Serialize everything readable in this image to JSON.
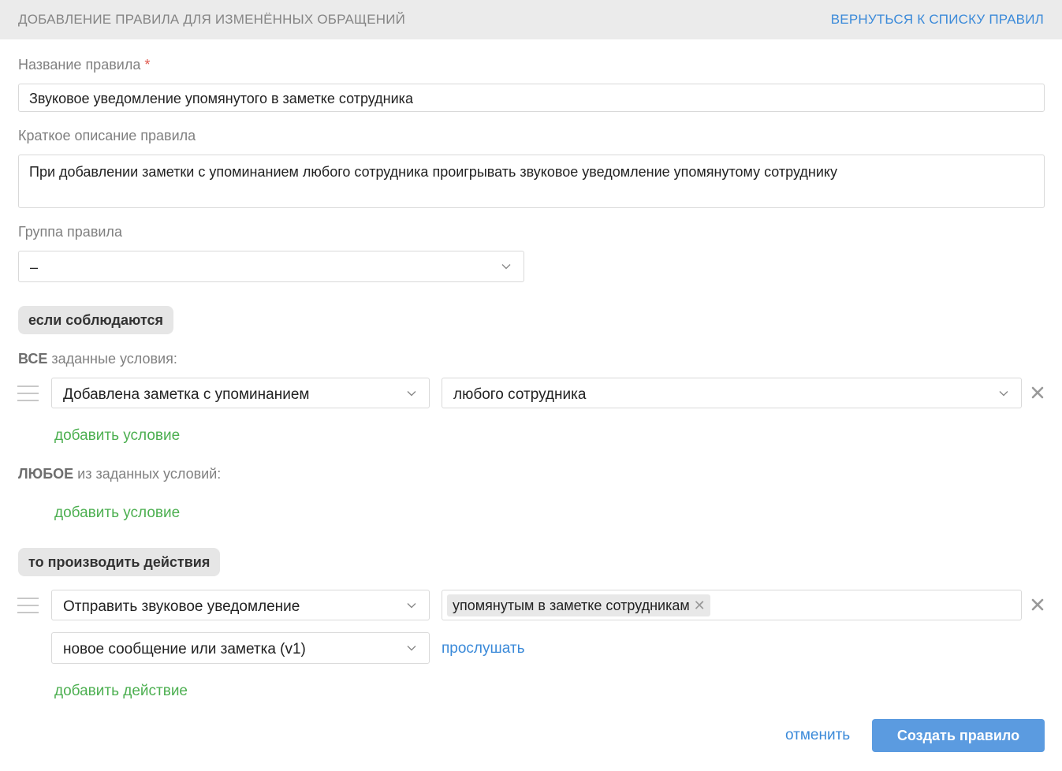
{
  "header": {
    "title": "ДОБАВЛЕНИЕ ПРАВИЛА ДЛЯ ИЗМЕНЁННЫХ ОБРАЩЕНИЙ",
    "back_link": "ВЕРНУТЬСЯ К СПИСКУ ПРАВИЛ"
  },
  "form": {
    "name_label": "Название правила",
    "required_mark": "*",
    "name_value": "Звуковое уведомление упомянутого в заметке сотрудника",
    "description_label": "Краткое описание правила",
    "description_value": "При добавлении заметки с упоминанием любого сотрудника проигрывать звуковое уведомление упомянутому сотруднику",
    "group_label": "Группа правила",
    "group_value": "–"
  },
  "conditions": {
    "section_label": "если соблюдаются",
    "all_keyword": "ВСЕ",
    "all_suffix": "заданные условия:",
    "all_items": [
      {
        "field": "Добавлена заметка с упоминанием",
        "value": "любого сотрудника"
      }
    ],
    "any_keyword": "ЛЮБОЕ",
    "any_suffix": "из заданных условий:",
    "add_condition": "добавить условие"
  },
  "actions": {
    "section_label": "то производить действия",
    "items": [
      {
        "action": "Отправить звуковое уведомление",
        "recipient_tag": "упомянутым в заметке сотрудникам",
        "sound": "новое сообщение или заметка (v1)",
        "listen": "прослушать"
      }
    ],
    "add_action": "добавить действие"
  },
  "footer": {
    "cancel": "отменить",
    "submit": "Создать правило"
  },
  "colors": {
    "accent_blue": "#3b8ad9",
    "primary_button": "#5b9be0",
    "add_link_green": "#4caf50",
    "required_red": "#e05a4f",
    "header_bg": "#ebebeb"
  },
  "icons": [
    "chevron-down-icon",
    "drag-handle-icon",
    "close-icon"
  ]
}
